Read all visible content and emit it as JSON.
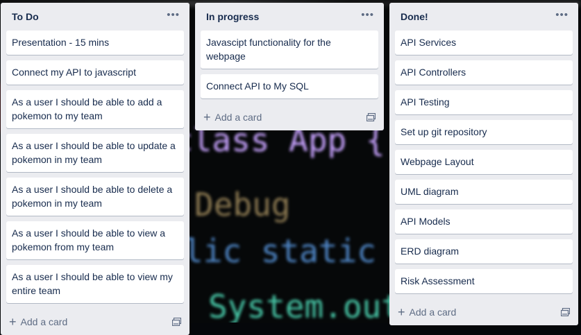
{
  "background": {
    "code_line_1": "class App {",
    "code_line_2": "Debug",
    "code_line_3": "lic static",
    "code_line_4": "System.out.prin"
  },
  "lists": [
    {
      "title": "To Do",
      "cards": [
        "Presentation - 15 mins",
        "Connect my API to javascript",
        "As a user I should be able to add a pokemon to my team",
        "As a user I should be able to update a pokemon in my team",
        "As a user I should be able to delete a pokemon in my team",
        "As a user I should be able to view a pokemon from my team",
        "As a user I should be able to view my entire team"
      ],
      "add_label": "Add a card"
    },
    {
      "title": "In progress",
      "cards": [
        "Javascipt functionality for the webpage",
        "Connect API to My SQL"
      ],
      "add_label": "Add a card"
    },
    {
      "title": "Done!",
      "cards": [
        "API Services",
        "API Controllers",
        "API Testing",
        "Set up git repository",
        "Webpage Layout",
        "UML diagram",
        "API Models",
        "ERD diagram",
        "Risk Assessment"
      ],
      "add_label": "Add a card"
    }
  ],
  "icons": {
    "menu": "more-horizontal-icon",
    "add": "plus-icon",
    "template": "card-template-icon"
  }
}
